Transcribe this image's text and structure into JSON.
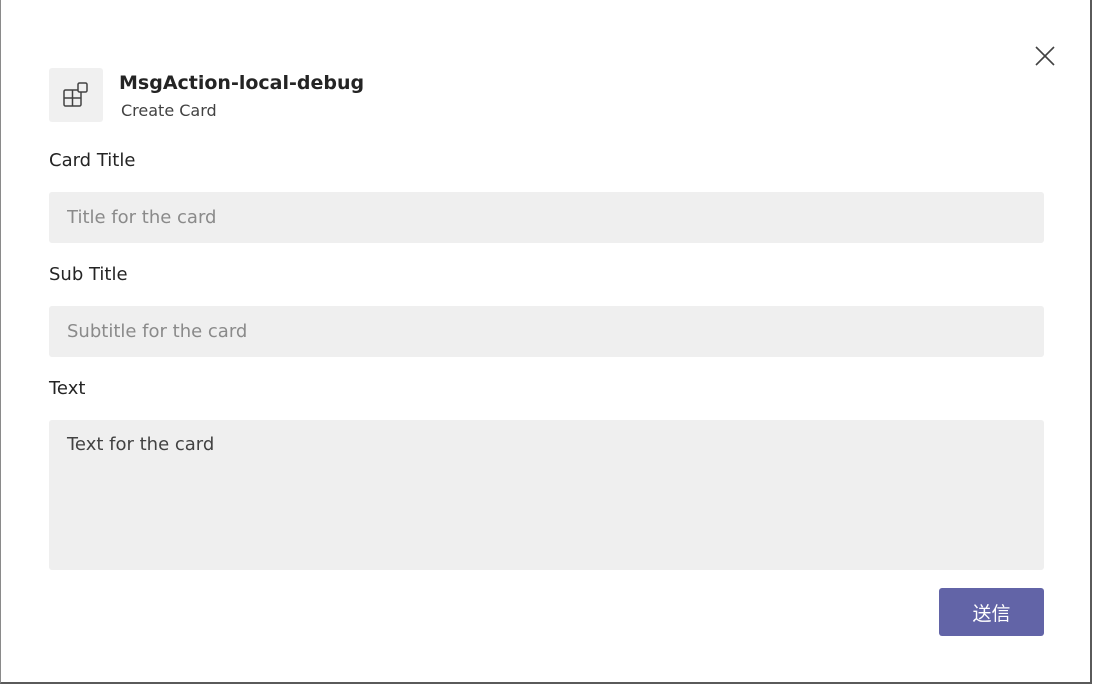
{
  "header": {
    "app_icon": "apps-grid-icon",
    "app_name": "MsgAction-local-debug",
    "command": "Create Card",
    "close_icon": "close-icon"
  },
  "form": {
    "title_label": "Card Title",
    "title_placeholder": "Title for the card",
    "title_value": "",
    "subtitle_label": "Sub Title",
    "subtitle_placeholder": "Subtitle for the card",
    "subtitle_value": "",
    "text_label": "Text",
    "text_value": "Text for the card"
  },
  "actions": {
    "submit_label": "送信"
  },
  "colors": {
    "accent": "#6264a7",
    "input_background": "#efefef"
  }
}
